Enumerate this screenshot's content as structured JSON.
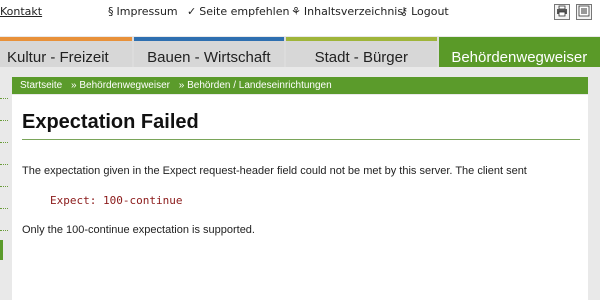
{
  "topbar": {
    "kontakt": "Kontakt",
    "impressum_icon": "§",
    "impressum": "Impressum",
    "seite_icon": "✓",
    "seite": "Seite empfehlen",
    "inhalt_icon": "⚘",
    "inhalt": "Inhaltsverzeichnis",
    "logout_icon": "⚷",
    "logout": "Logout",
    "print_icon": "printer-icon",
    "print_text_icon": "text-print-icon"
  },
  "nav": {
    "tabs": [
      {
        "label": "Kultur - Freizeit",
        "accent": "#e8913a"
      },
      {
        "label": "Bauen - Wirtschaft",
        "accent": "#2e6fb0"
      },
      {
        "label": "Stadt - Bürger",
        "accent": "#9fb53a"
      },
      {
        "label": "Behördenwegweiser",
        "accent": "#5a9a28"
      }
    ]
  },
  "breadcrumb": {
    "items": [
      "Startseite",
      "» Behördenwegweiser",
      "» Behörden / Landeseinrichtungen"
    ]
  },
  "content": {
    "title": "Expectation Failed",
    "paragraph1": "The expectation given in the Expect request-header field could not be met by this server. The client sent",
    "code": "Expect: 100-continue",
    "paragraph2": "Only the 100-continue expectation is supported."
  },
  "colors": {
    "brand_green": "#5b9b2b",
    "code_red": "#8b1a1a"
  }
}
